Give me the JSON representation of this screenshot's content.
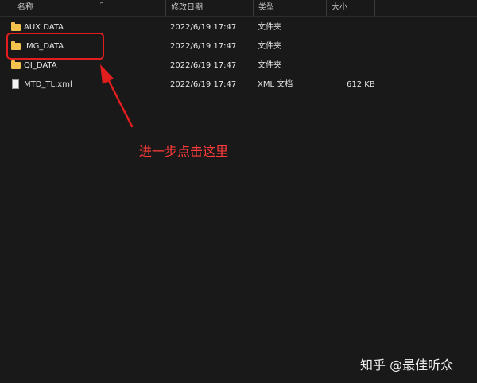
{
  "columns": {
    "name": "名称",
    "date": "修改日期",
    "type": "类型",
    "size": "大小"
  },
  "files": [
    {
      "name": "AUX DATA",
      "date": "2022/6/19 17:47",
      "type": "文件夹",
      "size": "",
      "icon": "folder-icon"
    },
    {
      "name": "IMG_DATA",
      "date": "2022/6/19 17:47",
      "type": "文件夹",
      "size": "",
      "icon": "folder-icon"
    },
    {
      "name": "QI_DATA",
      "date": "2022/6/19 17:47",
      "type": "文件夹",
      "size": "",
      "icon": "folder-icon"
    },
    {
      "name": "MTD_TL.xml",
      "date": "2022/6/19 17:47",
      "type": "XML 文档",
      "size": "612 KB",
      "icon": "file-icon"
    }
  ],
  "annotation": {
    "text": "进一步点击这里",
    "color": "#e11d1d"
  },
  "watermark": "知乎 @最佳听众",
  "colors": {
    "background": "#191919",
    "folder": "#f2c14e",
    "highlight": "#e11d1d"
  }
}
